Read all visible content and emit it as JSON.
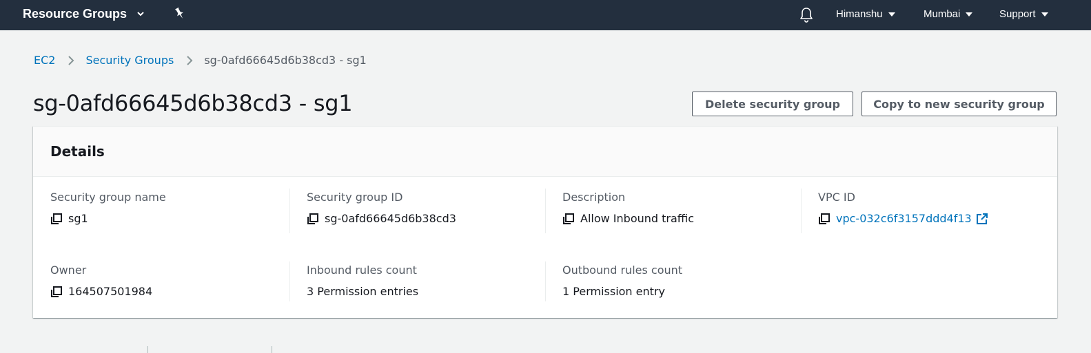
{
  "topbar": {
    "resource_groups": "Resource Groups",
    "user": "Himanshu",
    "region": "Mumbai",
    "support": "Support"
  },
  "breadcrumb": {
    "ec2": "EC2",
    "security_groups": "Security Groups",
    "current": "sg-0afd66645d6b38cd3 - sg1"
  },
  "page": {
    "title": "sg-0afd66645d6b38cd3 - sg1",
    "delete_button": "Delete security group",
    "copy_button": "Copy to new security group"
  },
  "details": {
    "heading": "Details",
    "fields": {
      "sg_name": {
        "label": "Security group name",
        "value": "sg1"
      },
      "sg_id": {
        "label": "Security group ID",
        "value": "sg-0afd66645d6b38cd3"
      },
      "description": {
        "label": "Description",
        "value": "Allow Inbound traffic"
      },
      "vpc_id": {
        "label": "VPC ID",
        "value": "vpc-032c6f3157ddd4f13"
      },
      "owner": {
        "label": "Owner",
        "value": "164507501984"
      },
      "inbound": {
        "label": "Inbound rules count",
        "value": "3 Permission entries"
      },
      "outbound": {
        "label": "Outbound rules count",
        "value": "1 Permission entry"
      }
    }
  },
  "colors": {
    "nav_bg": "#232f3e",
    "link": "#0073bb",
    "page_bg": "#f2f3f3",
    "secondary_text": "#545b64"
  },
  "icons": {
    "resource_groups_dropdown": "chevron-down-icon",
    "pin": "pushpin-icon",
    "notifications": "bell-icon",
    "copy": "copy-icon",
    "external_link": "external-link-icon",
    "breadcrumb_separator": "chevron-right-icon"
  }
}
